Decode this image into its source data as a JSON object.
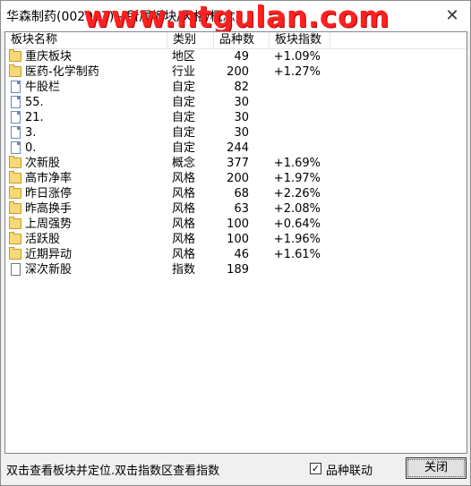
{
  "window": {
    "title": "华森制药(002907) - 所属板块/风格/概念",
    "watermark": "www.ntgulan.com",
    "close_symbol": "✕"
  },
  "columns": {
    "name": "板块名称",
    "category": "类别",
    "count": "品种数",
    "index": "板块指数"
  },
  "rows": [
    {
      "icon": "folder-icon",
      "name": "重庆板块",
      "category": "地区",
      "count": "49",
      "index": "+1.09%"
    },
    {
      "icon": "folder-icon",
      "name": "医药-化学制药",
      "category": "行业",
      "count": "200",
      "index": "+1.27%"
    },
    {
      "icon": "document-icon",
      "name": "牛股栏",
      "category": "自定",
      "count": "82",
      "index": ""
    },
    {
      "icon": "document-icon",
      "name": "55.",
      "category": "自定",
      "count": "30",
      "index": ""
    },
    {
      "icon": "document-icon",
      "name": "21.",
      "category": "自定",
      "count": "30",
      "index": ""
    },
    {
      "icon": "document-icon",
      "name": "3.",
      "category": "自定",
      "count": "30",
      "index": ""
    },
    {
      "icon": "document-icon",
      "name": "0.",
      "category": "自定",
      "count": "244",
      "index": ""
    },
    {
      "icon": "folder-icon",
      "name": "次新股",
      "category": "概念",
      "count": "377",
      "index": "+1.69%"
    },
    {
      "icon": "folder-icon",
      "name": "高市净率",
      "category": "风格",
      "count": "200",
      "index": "+1.97%"
    },
    {
      "icon": "folder-icon",
      "name": "昨日涨停",
      "category": "风格",
      "count": "68",
      "index": "+2.26%"
    },
    {
      "icon": "folder-icon",
      "name": "昨高换手",
      "category": "风格",
      "count": "63",
      "index": "+2.08%"
    },
    {
      "icon": "folder-icon",
      "name": "上周强势",
      "category": "风格",
      "count": "100",
      "index": "+0.64%"
    },
    {
      "icon": "folder-icon",
      "name": "活跃股",
      "category": "风格",
      "count": "100",
      "index": "+1.96%"
    },
    {
      "icon": "folder-icon",
      "name": "近期异动",
      "category": "风格",
      "count": "46",
      "index": "+1.61%"
    },
    {
      "icon": "blank-document-icon",
      "name": "深次新股",
      "category": "指数",
      "count": "189",
      "index": ""
    }
  ],
  "footer": {
    "hint": "双击查看板块并定位.双击指数区查看指数",
    "checkbox_label": "品种联动",
    "checkbox_checked": true,
    "checkbox_mark": "✓",
    "close_button": "关闭"
  }
}
